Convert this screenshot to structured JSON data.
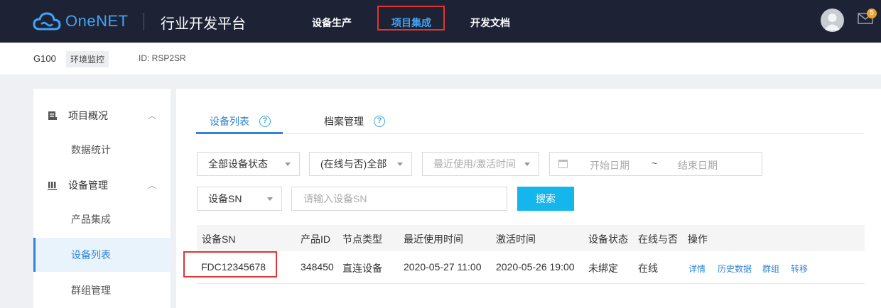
{
  "brand": {
    "name": "OneNET",
    "platform": "行业开发平台"
  },
  "nav": {
    "items": [
      "设备生产",
      "项目集成",
      "开发文档"
    ],
    "active": "项目集成"
  },
  "user": {
    "mail_count": "5"
  },
  "subheader": {
    "product": "G100",
    "tag": "环境监控",
    "id": "ID: RSP2SR"
  },
  "sidebar": {
    "group1": "项目概况",
    "group1_items": [
      "数据统计"
    ],
    "group2": "设备管理",
    "group2_items": [
      "产品集成",
      "设备列表",
      "群组管理"
    ]
  },
  "tabs": [
    "设备列表",
    "档案管理"
  ],
  "filters": {
    "status": "全部设备状态",
    "online": "(在线与否)全部",
    "time": "最近使用/激活时间",
    "start_date": "开始日期",
    "tilde": "~",
    "end_date": "结束日期",
    "sn_select": "设备SN",
    "sn_placeholder": "请输入设备SN",
    "search": "搜索"
  },
  "table": {
    "headers": [
      "设备SN",
      "产品ID",
      "节点类型",
      "最近使用时间",
      "激活时间",
      "设备状态",
      "在线与否",
      "操作"
    ],
    "rows": [
      {
        "sn": "FDC12345678",
        "product_id": "348450",
        "node_type": "直连设备",
        "last_used": "2020-05-27 11:00",
        "activated": "2020-05-26 19:00",
        "status": "未绑定",
        "online": "在线",
        "ops": [
          "详情",
          "历史数据",
          "群组",
          "转移"
        ]
      }
    ]
  },
  "colors": {
    "topbar": "#1d2235",
    "accent": "#2f84d4",
    "highlight": "#e33333",
    "search_button": "#15b6ec"
  }
}
